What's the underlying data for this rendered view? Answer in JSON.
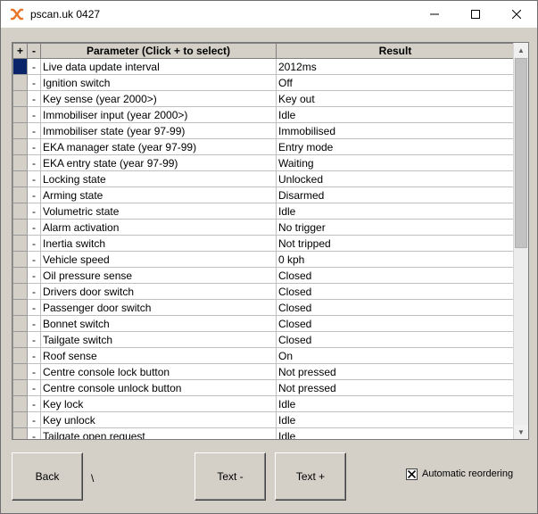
{
  "window": {
    "title": "pscan.uk 0427"
  },
  "grid": {
    "header": {
      "plus": "+",
      "minus": "-",
      "parameter": "Parameter (Click + to select)",
      "result": "Result"
    },
    "rows": [
      {
        "mark": "-",
        "parameter": "Live data update interval",
        "result": "2012ms"
      },
      {
        "mark": "-",
        "parameter": "Ignition switch",
        "result": "Off"
      },
      {
        "mark": "-",
        "parameter": "Key sense (year 2000>)",
        "result": "Key out"
      },
      {
        "mark": "-",
        "parameter": "Immobiliser input (year 2000>)",
        "result": "Idle"
      },
      {
        "mark": "-",
        "parameter": "Immobiliser state (year 97-99)",
        "result": "Immobilised"
      },
      {
        "mark": "-",
        "parameter": "EKA manager state (year 97-99)",
        "result": "Entry mode"
      },
      {
        "mark": "-",
        "parameter": "EKA entry state (year 97-99)",
        "result": "Waiting"
      },
      {
        "mark": "-",
        "parameter": "Locking state",
        "result": "Unlocked"
      },
      {
        "mark": "-",
        "parameter": "Arming state",
        "result": "Disarmed"
      },
      {
        "mark": "-",
        "parameter": "Volumetric state",
        "result": "Idle"
      },
      {
        "mark": "-",
        "parameter": "Alarm activation",
        "result": "No trigger"
      },
      {
        "mark": "-",
        "parameter": "Inertia switch",
        "result": "Not tripped"
      },
      {
        "mark": "-",
        "parameter": "Vehicle speed",
        "result": "0 kph"
      },
      {
        "mark": "-",
        "parameter": "Oil pressure sense",
        "result": "Closed"
      },
      {
        "mark": "-",
        "parameter": "Drivers door switch",
        "result": "Closed"
      },
      {
        "mark": "-",
        "parameter": "Passenger door switch",
        "result": "Closed"
      },
      {
        "mark": "-",
        "parameter": "Bonnet switch",
        "result": "Closed"
      },
      {
        "mark": "-",
        "parameter": "Tailgate switch",
        "result": "Closed"
      },
      {
        "mark": "-",
        "parameter": "Roof sense",
        "result": "On"
      },
      {
        "mark": "-",
        "parameter": "Centre console lock button",
        "result": "Not pressed"
      },
      {
        "mark": "-",
        "parameter": "Centre console unlock button",
        "result": "Not pressed"
      },
      {
        "mark": "-",
        "parameter": "Key lock",
        "result": "Idle"
      },
      {
        "mark": "-",
        "parameter": "Key unlock",
        "result": "Idle"
      },
      {
        "mark": "-",
        "parameter": "Tailgate open request",
        "result": "Idle"
      }
    ]
  },
  "buttons": {
    "back": "Back",
    "text_minus": "Text -",
    "text_plus": "Text +"
  },
  "status_text": "\\",
  "checkbox": {
    "label": "Automatic reordering",
    "checked": true
  },
  "colors": {
    "selected_cell": "#0a246a",
    "app_icon": "#e8762b"
  }
}
